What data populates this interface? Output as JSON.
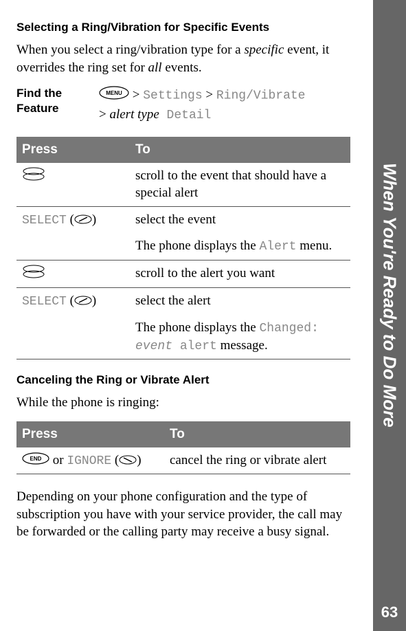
{
  "section1": {
    "heading": "Selecting a Ring/Vibration for Specific Events",
    "intro_pre": "When you select a ring/vibration type for a ",
    "intro_specific": "specific",
    "intro_mid": " event, it overrides the ring set for ",
    "intro_all": "all",
    "intro_post": " events.",
    "find_label_l1": "Find the",
    "find_label_l2": "Feature",
    "path_gt1": " > ",
    "path_settings": "Settings",
    "path_gt2": " > ",
    "path_ringvib": "Ring/Vibrate",
    "path_line2_gt": "> ",
    "path_alert_type": "alert type",
    "path_detail": " Detail"
  },
  "table1": {
    "h_press": "Press",
    "h_to": "To",
    "r1_to": "scroll to the event that should have a special alert",
    "r2_press": "SELECT",
    "r2_to_a": "select the event",
    "r2_to_b_pre": "The phone displays the ",
    "r2_to_b_mono": "Alert",
    "r2_to_b_post": " menu.",
    "r3_to": "scroll to the alert you want",
    "r4_press": "SELECT",
    "r4_to_a": "select the alert",
    "r4_to_b_pre": "The phone displays the ",
    "r4_to_b_mono": "Changed: ",
    "r4_to_b_mono2_pre": "",
    "r4_to_b_mono2_em": "event",
    "r4_to_b_mono3": " alert",
    "r4_to_b_post": " message."
  },
  "section2": {
    "heading": "Canceling the Ring or Vibrate Alert",
    "intro": "While the phone is ringing:"
  },
  "table2": {
    "h_press": "Press",
    "h_to": "To",
    "r1_or": " or ",
    "r1_ignore": "IGNORE",
    "r1_to": "cancel the ring or vibrate alert"
  },
  "footer_para": "Depending on your phone configuration and the type of subscription you have with your service provider, the call may be forwarded or the calling party may receive a busy signal.",
  "side_tab": "When You're Ready to Do More",
  "page_num": "63"
}
